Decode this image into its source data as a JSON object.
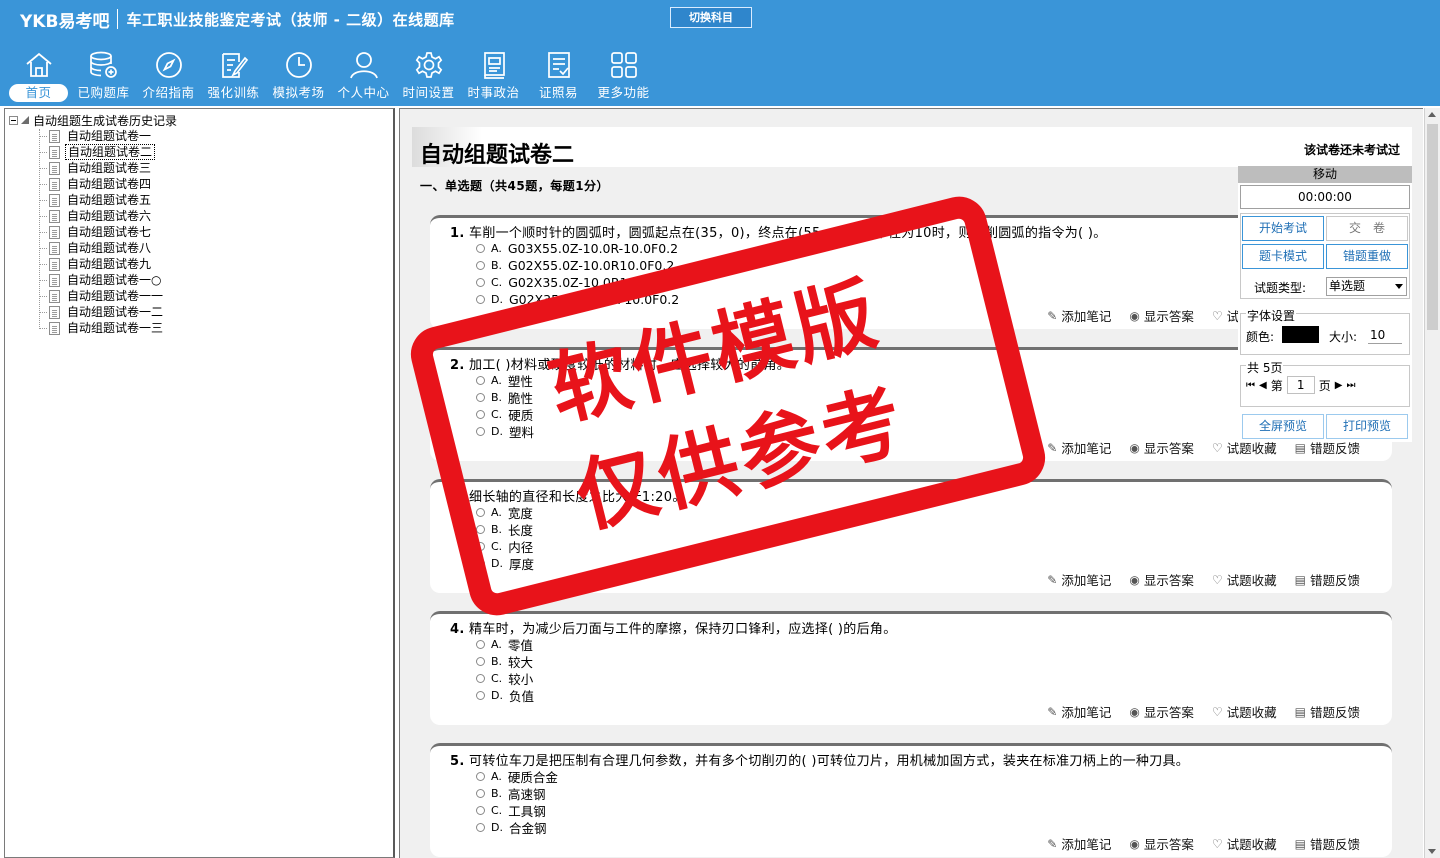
{
  "app": {
    "logo": "YKB易考吧",
    "title": "车工职业技能鉴定考试（技师 - 二级）在线题库",
    "switch_label": "切换科目"
  },
  "nav": [
    {
      "label": "首页",
      "icon": "home-icon"
    },
    {
      "label": "已购题库",
      "icon": "database-icon"
    },
    {
      "label": "介绍指南",
      "icon": "compass-icon"
    },
    {
      "label": "强化训练",
      "icon": "edit-icon"
    },
    {
      "label": "模拟考场",
      "icon": "clock-icon"
    },
    {
      "label": "个人中心",
      "icon": "user-icon"
    },
    {
      "label": "时间设置",
      "icon": "gear-icon"
    },
    {
      "label": "时事政治",
      "icon": "book-icon"
    },
    {
      "label": "证照易",
      "icon": "certificate-icon"
    },
    {
      "label": "更多功能",
      "icon": "grid-icon"
    }
  ],
  "tree": {
    "root": "自动组题生成试卷历史记录",
    "items": [
      "自动组题试卷一",
      "自动组题试卷二",
      "自动组题试卷三",
      "自动组题试卷四",
      "自动组题试卷五",
      "自动组题试卷六",
      "自动组题试卷七",
      "自动组题试卷八",
      "自动组题试卷九",
      "自动组题试卷一○",
      "自动组题试卷一一",
      "自动组题试卷一二",
      "自动组题试卷一三"
    ],
    "selected_index": 1
  },
  "paper": {
    "title": "自动组题试卷二",
    "status": "该试卷还未考试过",
    "section": "一、单选题（共45题，每题1分）"
  },
  "questions": [
    {
      "num": "1.",
      "text": "车削一个顺时针的圆弧时，圆弧起点在(35，0)，终点在(55，-10)，半径为10时，则车削圆弧的指令为( )。",
      "options": [
        {
          "l": "A.",
          "t": "G03X55.0Z-10.0R-10.0F0.2"
        },
        {
          "l": "B.",
          "t": "G02X55.0Z-10.0R10.0F0.2"
        },
        {
          "l": "C.",
          "t": "G02X35.0Z-10.0R10.0F0.2"
        },
        {
          "l": "D.",
          "t": "G02X35.0Z-10.0R-10.0F0.2"
        }
      ]
    },
    {
      "num": "2.",
      "text": "加工( )材料或硬度较低的材料时，应选择较大的前角。",
      "options": [
        {
          "l": "A.",
          "t": "塑性"
        },
        {
          "l": "B.",
          "t": "脆性"
        },
        {
          "l": "C.",
          "t": "硬质"
        },
        {
          "l": "D.",
          "t": "塑料"
        }
      ]
    },
    {
      "num": "3.",
      "text": "细长轴的直径和长度之比大于1:20。",
      "options": [
        {
          "l": "A.",
          "t": "宽度"
        },
        {
          "l": "B.",
          "t": "长度"
        },
        {
          "l": "C.",
          "t": "内径"
        },
        {
          "l": "D.",
          "t": "厚度"
        }
      ]
    },
    {
      "num": "4.",
      "text": "精车时，为减少后刀面与工件的摩擦，保持刃口锋利，应选择( )的后角。",
      "options": [
        {
          "l": "A.",
          "t": "零值"
        },
        {
          "l": "B.",
          "t": "较大"
        },
        {
          "l": "C.",
          "t": "较小"
        },
        {
          "l": "D.",
          "t": "负值"
        }
      ]
    },
    {
      "num": "5.",
      "text": "可转位车刀是把压制有合理几何参数，并有多个切削刃的( )可转位刀片，用机械加固方式，装夹在标准刀柄上的一种刀具。",
      "options": [
        {
          "l": "A.",
          "t": "硬质合金"
        },
        {
          "l": "B.",
          "t": "高速钢"
        },
        {
          "l": "C.",
          "t": "工具钢"
        },
        {
          "l": "D.",
          "t": "合金钢"
        }
      ]
    }
  ],
  "actions": {
    "note": "添加笔记",
    "answer": "显示答案",
    "fav": "试题收藏",
    "feedback": "错题反馈"
  },
  "panel": {
    "move": "移动",
    "timer": "00:00:00",
    "start": "开始考试",
    "submit": "交　卷",
    "card_mode": "题卡模式",
    "redo": "错题重做",
    "type_label": "试题类型:",
    "type_value": "单选题",
    "font_title": "字体设置",
    "color_label": "颜色:",
    "size_label": "大小:",
    "size_value": "10",
    "pages_total": "共 5页",
    "page_prefix": "第",
    "page_value": "1",
    "page_suffix": "页",
    "fullscreen": "全屏预览",
    "print": "打印预览"
  },
  "watermark": {
    "line1": "软件模版",
    "line2": "仅供参考",
    "color": "#e8131a"
  },
  "colors": {
    "header": "#3a95d8"
  }
}
